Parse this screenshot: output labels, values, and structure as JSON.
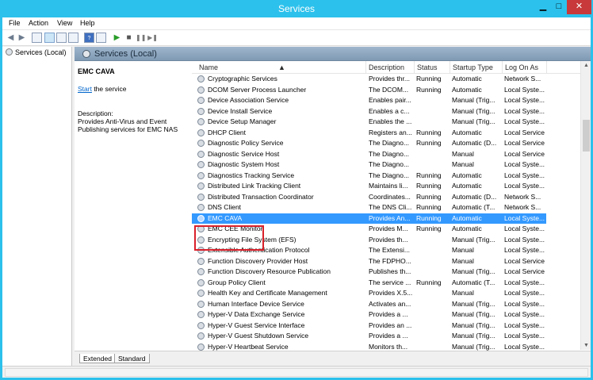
{
  "window": {
    "title": "Services",
    "min_glyph": "▁",
    "max_glyph": "□",
    "close_glyph": "✕"
  },
  "menu": [
    "File",
    "Action",
    "View",
    "Help"
  ],
  "toolbar": {
    "back_icon": "◀",
    "forward_icon": "▶",
    "play_icon": "▶",
    "stop_icon": "■",
    "pause_icon": "❚❚",
    "restart_icon": "▶❚"
  },
  "tree": {
    "item": "Services (Local)"
  },
  "content": {
    "header": "Services (Local)",
    "selected_service": "EMC CAVA",
    "start_link": "Start",
    "start_suffix": " the service",
    "description_label": "Description:",
    "description_text": "Provides Anti-Virus and Event Publishing services for EMC NAS"
  },
  "columns": {
    "name": "Name",
    "description": "Description",
    "status": "Status",
    "startup": "Startup Type",
    "logon": "Log On As",
    "sort_glyph": "▲"
  },
  "rows": [
    {
      "name": "Cryptographic Services",
      "description": "Provides thr...",
      "status": "Running",
      "startup": "Automatic",
      "logon": "Network S..."
    },
    {
      "name": "DCOM Server Process Launcher",
      "description": "The DCOM...",
      "status": "Running",
      "startup": "Automatic",
      "logon": "Local Syste..."
    },
    {
      "name": "Device Association Service",
      "description": "Enables pair...",
      "status": "",
      "startup": "Manual (Trig...",
      "logon": "Local Syste..."
    },
    {
      "name": "Device Install Service",
      "description": "Enables a c...",
      "status": "",
      "startup": "Manual (Trig...",
      "logon": "Local Syste..."
    },
    {
      "name": "Device Setup Manager",
      "description": "Enables the ...",
      "status": "",
      "startup": "Manual (Trig...",
      "logon": "Local Syste..."
    },
    {
      "name": "DHCP Client",
      "description": "Registers an...",
      "status": "Running",
      "startup": "Automatic",
      "logon": "Local Service"
    },
    {
      "name": "Diagnostic Policy Service",
      "description": "The Diagno...",
      "status": "Running",
      "startup": "Automatic (D...",
      "logon": "Local Service"
    },
    {
      "name": "Diagnostic Service Host",
      "description": "The Diagno...",
      "status": "",
      "startup": "Manual",
      "logon": "Local Service"
    },
    {
      "name": "Diagnostic System Host",
      "description": "The Diagno...",
      "status": "",
      "startup": "Manual",
      "logon": "Local Syste..."
    },
    {
      "name": "Diagnostics Tracking Service",
      "description": "The Diagno...",
      "status": "Running",
      "startup": "Automatic",
      "logon": "Local Syste..."
    },
    {
      "name": "Distributed Link Tracking Client",
      "description": "Maintains li...",
      "status": "Running",
      "startup": "Automatic",
      "logon": "Local Syste..."
    },
    {
      "name": "Distributed Transaction Coordinator",
      "description": "Coordinates...",
      "status": "Running",
      "startup": "Automatic (D...",
      "logon": "Network S..."
    },
    {
      "name": "DNS Client",
      "description": "The DNS Cli...",
      "status": "Running",
      "startup": "Automatic (T...",
      "logon": "Network S..."
    },
    {
      "name": "EMC CAVA",
      "description": "Provides An...",
      "status": "Running",
      "startup": "Automatic",
      "logon": "Local Syste...",
      "selected": true
    },
    {
      "name": "EMC CEE Monitor",
      "description": "Provides M...",
      "status": "Running",
      "startup": "Automatic",
      "logon": "Local Syste..."
    },
    {
      "name": "Encrypting File System (EFS)",
      "description": "Provides th...",
      "status": "",
      "startup": "Manual (Trig...",
      "logon": "Local Syste..."
    },
    {
      "name": "Extensible Authentication Protocol",
      "description": "The Extensi...",
      "status": "",
      "startup": "Manual",
      "logon": "Local Syste..."
    },
    {
      "name": "Function Discovery Provider Host",
      "description": "The FDPHO...",
      "status": "",
      "startup": "Manual",
      "logon": "Local Service"
    },
    {
      "name": "Function Discovery Resource Publication",
      "description": "Publishes th...",
      "status": "",
      "startup": "Manual (Trig...",
      "logon": "Local Service"
    },
    {
      "name": "Group Policy Client",
      "description": "The service ...",
      "status": "Running",
      "startup": "Automatic (T...",
      "logon": "Local Syste..."
    },
    {
      "name": "Health Key and Certificate Management",
      "description": "Provides X.5...",
      "status": "",
      "startup": "Manual",
      "logon": "Local Syste..."
    },
    {
      "name": "Human Interface Device Service",
      "description": "Activates an...",
      "status": "",
      "startup": "Manual (Trig...",
      "logon": "Local Syste..."
    },
    {
      "name": "Hyper-V Data Exchange Service",
      "description": "Provides a ...",
      "status": "",
      "startup": "Manual (Trig...",
      "logon": "Local Syste..."
    },
    {
      "name": "Hyper-V Guest Service Interface",
      "description": "Provides an ...",
      "status": "",
      "startup": "Manual (Trig...",
      "logon": "Local Syste..."
    },
    {
      "name": "Hyper-V Guest Shutdown Service",
      "description": "Provides a ...",
      "status": "",
      "startup": "Manual (Trig...",
      "logon": "Local Syste..."
    },
    {
      "name": "Hyper-V Heartbeat Service",
      "description": "Monitors th...",
      "status": "",
      "startup": "Manual (Trig...",
      "logon": "Local Syste..."
    }
  ],
  "tabs": [
    "Extended",
    "Standard"
  ],
  "scroll": {
    "up": "▲",
    "down": "▼"
  }
}
